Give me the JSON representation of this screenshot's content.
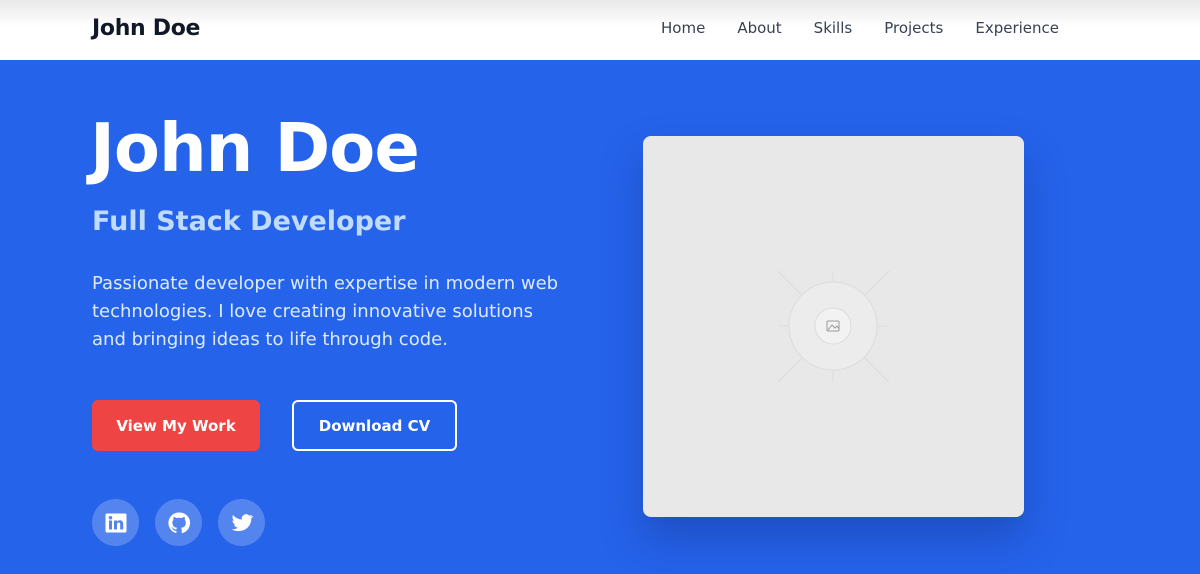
{
  "navbar": {
    "brand": "John Doe",
    "links": [
      "Home",
      "About",
      "Skills",
      "Projects",
      "Experience"
    ]
  },
  "hero": {
    "name": "John Doe",
    "role": "Full Stack Developer",
    "description": "Passionate developer with expertise in modern web technologies. I love creating innovative solutions and bringing ideas to life through code.",
    "primary_button": "View My Work",
    "secondary_button": "Download CV",
    "socials": [
      "linkedin-icon",
      "github-icon",
      "twitter-icon"
    ],
    "image_placeholder_icon": "image-icon"
  },
  "colors": {
    "hero_bg": "#2563eb",
    "primary_button": "#ef4444",
    "role_text": "#bfdbfe"
  }
}
